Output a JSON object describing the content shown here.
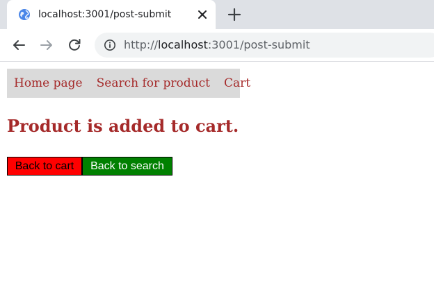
{
  "browser": {
    "tab": {
      "title": "localhost:3001/post-submit",
      "favicon": "globe-icon",
      "close_icon": "close-icon"
    },
    "new_tab_icon": "plus-icon",
    "toolbar": {
      "back_icon": "back-arrow-icon",
      "forward_icon": "forward-arrow-icon",
      "reload_icon": "reload-icon",
      "info_icon": "info-icon"
    },
    "address": {
      "scheme": "http://",
      "host": "localhost",
      "rest": ":3001/post-submit"
    }
  },
  "nav": {
    "items": [
      {
        "label": "Home page"
      },
      {
        "label": "Search for product"
      },
      {
        "label": "Cart"
      }
    ]
  },
  "main": {
    "heading": "Product is added to cart.",
    "buttons": {
      "back_to_cart": "Back to cart",
      "back_to_search": "Back to search"
    }
  },
  "colors": {
    "link": "#a52a2a",
    "nav_bg": "#dadada",
    "button_red": "#ff0000",
    "button_green": "#008000"
  }
}
